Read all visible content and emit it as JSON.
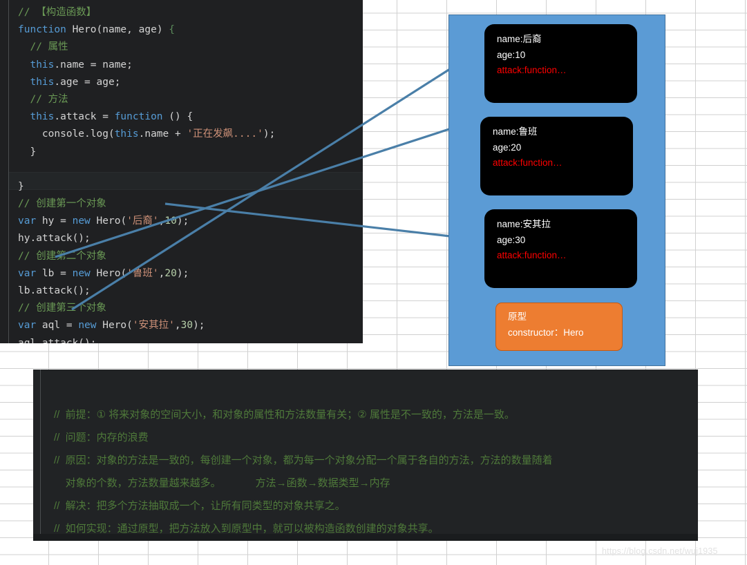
{
  "code_panel": {
    "language": "javascript",
    "lines": [
      {
        "segments": [
          {
            "t": "// 【构造函数】",
            "c": "cmt"
          }
        ]
      },
      {
        "segments": [
          {
            "t": "function ",
            "c": "kw"
          },
          {
            "t": "Hero",
            "c": "id"
          },
          {
            "t": "(",
            "c": "pun"
          },
          {
            "t": "name, age",
            "c": "id"
          },
          {
            "t": ") ",
            "c": "pun"
          },
          {
            "t": "{",
            "c": "brk"
          }
        ]
      },
      {
        "segments": [
          {
            "t": "  ",
            "c": "pun"
          },
          {
            "t": "// 属性",
            "c": "cmt"
          }
        ]
      },
      {
        "segments": [
          {
            "t": "  ",
            "c": "pun"
          },
          {
            "t": "this",
            "c": "kw"
          },
          {
            "t": ".name = name;",
            "c": "id"
          }
        ]
      },
      {
        "segments": [
          {
            "t": "  ",
            "c": "pun"
          },
          {
            "t": "this",
            "c": "kw"
          },
          {
            "t": ".age = age;",
            "c": "id"
          }
        ]
      },
      {
        "segments": [
          {
            "t": "  ",
            "c": "pun"
          },
          {
            "t": "// 方法",
            "c": "cmt"
          }
        ]
      },
      {
        "segments": [
          {
            "t": "  ",
            "c": "pun"
          },
          {
            "t": "this",
            "c": "kw"
          },
          {
            "t": ".attack = ",
            "c": "id"
          },
          {
            "t": "function",
            "c": "kw"
          },
          {
            "t": " () {",
            "c": "pun"
          }
        ]
      },
      {
        "segments": [
          {
            "t": "    console.log(",
            "c": "id"
          },
          {
            "t": "this",
            "c": "kw"
          },
          {
            "t": ".name + ",
            "c": "id"
          },
          {
            "t": "'正在发飙....'",
            "c": "str"
          },
          {
            "t": ");",
            "c": "pun"
          }
        ]
      },
      {
        "segments": [
          {
            "t": "  }",
            "c": "pun"
          }
        ]
      },
      {
        "segments": [
          {
            "t": "",
            "c": "pun"
          }
        ]
      },
      {
        "segments": [
          {
            "t": "}",
            "c": "pun"
          }
        ]
      },
      {
        "segments": [
          {
            "t": "// 创建第一个对象",
            "c": "cmt"
          }
        ]
      },
      {
        "segments": [
          {
            "t": "var",
            "c": "kw"
          },
          {
            "t": " hy = ",
            "c": "id"
          },
          {
            "t": "new",
            "c": "kw"
          },
          {
            "t": " Hero(",
            "c": "id"
          },
          {
            "t": "'后裔'",
            "c": "str"
          },
          {
            "t": ",",
            "c": "pun"
          },
          {
            "t": "10",
            "c": "num"
          },
          {
            "t": ");",
            "c": "pun"
          }
        ]
      },
      {
        "segments": [
          {
            "t": "hy.attack();",
            "c": "id"
          }
        ]
      },
      {
        "segments": [
          {
            "t": "// 创建第二个对象",
            "c": "cmt"
          }
        ]
      },
      {
        "segments": [
          {
            "t": "var",
            "c": "kw"
          },
          {
            "t": " lb = ",
            "c": "id"
          },
          {
            "t": "new",
            "c": "kw"
          },
          {
            "t": " Hero(",
            "c": "id"
          },
          {
            "t": "'鲁班'",
            "c": "str"
          },
          {
            "t": ",",
            "c": "pun"
          },
          {
            "t": "20",
            "c": "num"
          },
          {
            "t": ");",
            "c": "pun"
          }
        ]
      },
      {
        "segments": [
          {
            "t": "lb.attack();",
            "c": "id"
          }
        ]
      },
      {
        "segments": [
          {
            "t": "// 创建第三个对象",
            "c": "cmt"
          }
        ]
      },
      {
        "segments": [
          {
            "t": "var",
            "c": "kw"
          },
          {
            "t": " aql = ",
            "c": "id"
          },
          {
            "t": "new",
            "c": "kw"
          },
          {
            "t": " Hero(",
            "c": "id"
          },
          {
            "t": "'安其拉'",
            "c": "str"
          },
          {
            "t": ",",
            "c": "pun"
          },
          {
            "t": "30",
            "c": "num"
          },
          {
            "t": ");",
            "c": "pun"
          }
        ]
      },
      {
        "segments": [
          {
            "t": "aql.attack();",
            "c": "id"
          }
        ]
      }
    ]
  },
  "memory_panel": {
    "background_color": "#5b9bd5",
    "border_color": "#41719c",
    "objects": [
      {
        "name_row": "name:后裔",
        "age_row": "age:10",
        "attack_row": "attack:function…"
      },
      {
        "name_row": "name:鲁班",
        "age_row": "age:20",
        "attack_row": "attack:function…"
      },
      {
        "name_row": "name:安其拉",
        "age_row": "age:30",
        "attack_row": "attack:function…"
      }
    ],
    "prototype_box": {
      "title": "原型",
      "constructor_row": "constructor：Hero",
      "fill_color": "#ed7d31",
      "border_color": "#c55a11"
    }
  },
  "arrows": {
    "color": "#4a7fa8",
    "head_color": "#7a8f9e",
    "count": 3,
    "labels": [
      "arrow-hy-to-object1",
      "arrow-lb-to-object2",
      "arrow-aql-to-object3"
    ]
  },
  "notes_panel": {
    "background_color": "#212325",
    "text_color": "#4f7a3a",
    "lines": [
      "//  前提：① 将来对象的空间大小，和对象的属性和方法数量有关；② 属性是不一致的，方法是一致。",
      "//  问题：内存的浪费",
      "//  原因：对象的方法是一致的，每创建一个对象，都为每一个对象分配一个属于各自的方法，方法的数量随着",
      "    对象的个数，方法数量越来越多。            方法→函数→数据类型→内存",
      "//  解决：把多个方法抽取成一个，让所有同类型的对象共享之。",
      "//  如何实现：通过原型，把方法放入到原型中，就可以被构造函数创建的对象共享。"
    ]
  },
  "watermark": {
    "text": "https://blog.csdn.net/wuj1935"
  }
}
